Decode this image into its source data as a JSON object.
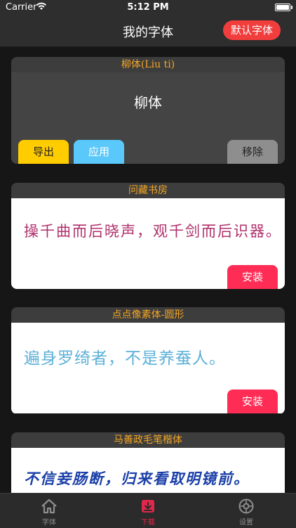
{
  "status_bar": {
    "carrier": "Carrier",
    "time": "5:12 PM"
  },
  "nav": {
    "title": "我的字体",
    "default_font_button": "默认字体"
  },
  "current_font": {
    "name": "柳体(Liu ti)",
    "preview": "柳体",
    "export_label": "导出",
    "apply_label": "应用",
    "remove_label": "移除"
  },
  "fonts": [
    {
      "name": "问藏书房",
      "sample": "操千曲而后晓声，观千剑而后识器。",
      "install_label": "安装",
      "sample_color": "#b0306b"
    },
    {
      "name": "点点像素体-圆形",
      "sample": "遍身罗绮者，不是养蚕人。",
      "install_label": "安装",
      "sample_color": "#5bb0d8"
    },
    {
      "name": "马善政毛笔楷体",
      "sample": "不信妾肠断，归来看取明镜前。",
      "sample_color": "#1a3fa8"
    }
  ],
  "tabs": [
    {
      "label": "字体",
      "icon": "home-icon"
    },
    {
      "label": "下载",
      "icon": "download-icon",
      "active": true
    },
    {
      "label": "设置",
      "icon": "settings-icon"
    }
  ],
  "colors": {
    "accent": "#f23d3d",
    "header_text": "#f5a623",
    "active_tab": "#e0284a"
  }
}
